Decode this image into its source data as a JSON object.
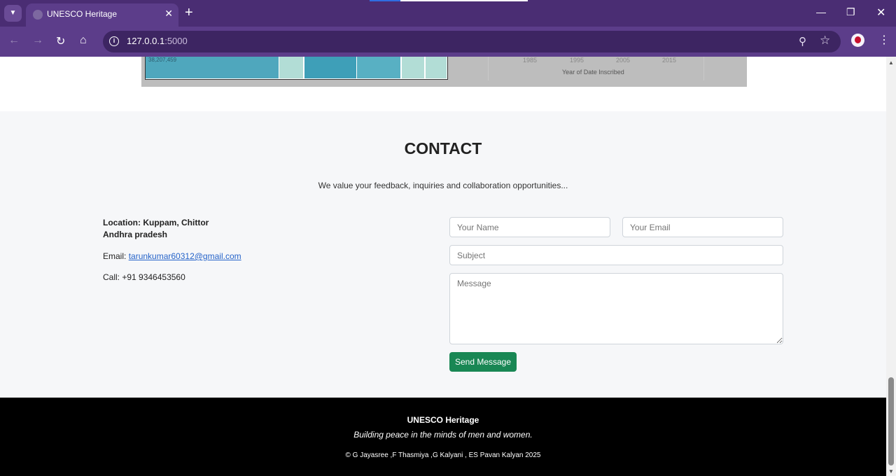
{
  "browser": {
    "tab_title": "UNESCO Heritage",
    "tab_close": "✕",
    "new_tab": "+",
    "url_host": "127.0.0.1",
    "url_port": ":5000",
    "colors": {
      "frame": "#4a2d73",
      "toolbar": "#5c3d8a",
      "omnibox": "#3d2562"
    }
  },
  "chart_remnant": {
    "label": "38,207,459",
    "ticks": [
      "1985",
      "1995",
      "2005",
      "2015"
    ],
    "axis_title": "Year of Date Inscribed",
    "cell_colors": [
      "#4fa7bd",
      "#b2ddd6",
      "#3e9fb8",
      "#58b0c3",
      "#b2ddd6",
      "#b2ddd6"
    ]
  },
  "contact": {
    "title": "CONTACT",
    "subtitle": "We value your feedback, inquiries and collaboration opportunities...",
    "location_line1": "Location: Kuppam, Chittor",
    "location_line2": "Andhra pradesh",
    "email_label": "Email: ",
    "email": "tarunkumar60312@gmail.com",
    "call": "Call: +91 9346453560",
    "form": {
      "name_placeholder": "Your Name",
      "email_placeholder": "Your Email",
      "subject_placeholder": "Subject",
      "message_placeholder": "Message",
      "send_label": "Send Message"
    },
    "colors": {
      "send_button": "#198754",
      "background": "#f6f7f9"
    }
  },
  "footer": {
    "title": "UNESCO Heritage",
    "tagline": "Building peace in the minds of men and women.",
    "copyright": "© G Jayasree ,F Thasmiya ,G Kalyani , ES Pavan Kalyan 2025"
  }
}
